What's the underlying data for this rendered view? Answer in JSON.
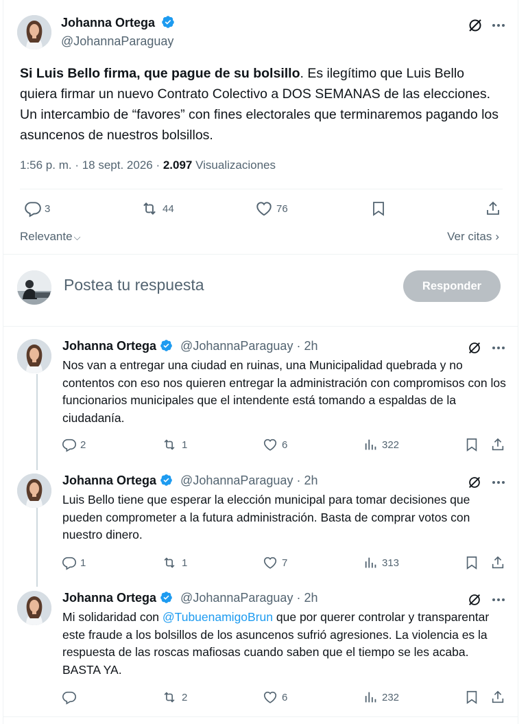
{
  "main": {
    "author_name": "Johanna Ortega",
    "author_handle": "@JohannaParaguay",
    "text_bold": "Si Luis Bello firma, que pague de su bolsillo",
    "text_rest": ". Es ilegítimo que Luis Bello quiera firmar un nuevo Contrato Colectivo a DOS SEMANAS de las elecciones. Un intercambio de “favores” con fines electorales que terminaremos pagando los asuncenos de nuestros bolsillos.",
    "time": "1:56 p. m. · 18 sept. 2026 · ",
    "views_count": "2.097",
    "views_label": " Visualizaciones",
    "replies": "3",
    "reposts": "44",
    "likes": "76"
  },
  "sort": {
    "relevant": "Relevante",
    "quotes": "Ver citas"
  },
  "compose": {
    "placeholder": "Postea tu respuesta",
    "button": "Responder"
  },
  "replies": [
    {
      "name": "Johanna Ortega",
      "handle": "@JohannaParaguay",
      "time": "2h",
      "text": "Nos van a entregar una ciudad en ruinas, una Municipalidad quebrada y no contentos con eso nos quieren  entregar la administración con compromisos con los funcionarios municipales que el intendente está tomando a espaldas de la ciudadanía.",
      "replies": "2",
      "reposts": "1",
      "likes": "6",
      "views": "322"
    },
    {
      "name": "Johanna Ortega",
      "handle": "@JohannaParaguay",
      "time": "2h",
      "text": "Luis Bello tiene que esperar la elección municipal para tomar decisiones que pueden comprometer a la futura administración. Basta de comprar votos con nuestro dinero.",
      "replies": "1",
      "reposts": "1",
      "likes": "7",
      "views": "313"
    },
    {
      "name": "Johanna Ortega",
      "handle": "@JohannaParaguay",
      "time": "2h",
      "text_pre": "Mi solidaridad con ",
      "mention": "@TubuenamigoBrun",
      "text_post": " que por querer controlar y transparentar este fraude a los bolsillos de los asuncenos sufrió agresiones. La violencia es la respuesta de las roscas mafiosas cuando saben que el tiempo se les acaba. BASTA YA.",
      "replies": "",
      "reposts": "2",
      "likes": "6",
      "views": "232"
    }
  ],
  "colors": {
    "text": "#0f1419",
    "secondary": "#536471",
    "link": "#1d9bf0",
    "verified": "#1d9bf0",
    "button_disabled": "#b9bfc4"
  },
  "icons": [
    "grok-icon",
    "more-icon",
    "reply-icon",
    "repost-icon",
    "like-icon",
    "bookmark-icon",
    "share-icon",
    "views-icon",
    "verified-badge-icon"
  ]
}
